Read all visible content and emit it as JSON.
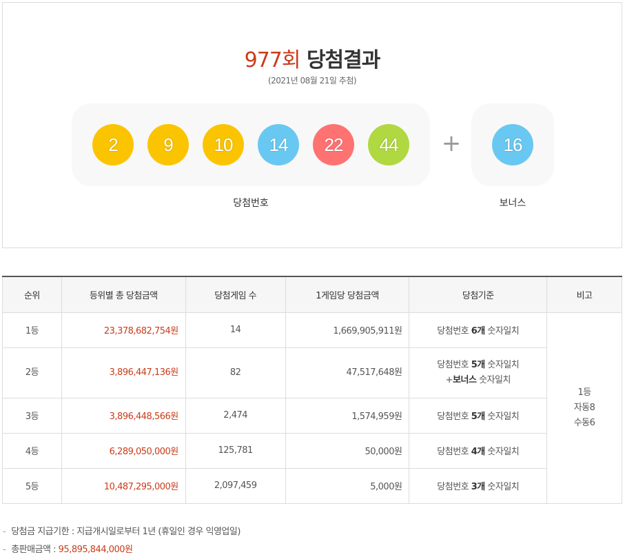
{
  "header": {
    "round": "977회",
    "title_suffix": "당첨결과",
    "draw_date": "(2021년 08월 21일 추첨)"
  },
  "numbers": [
    {
      "value": "2",
      "color": "#fbc400"
    },
    {
      "value": "9",
      "color": "#fbc400"
    },
    {
      "value": "10",
      "color": "#fbc400"
    },
    {
      "value": "14",
      "color": "#69c8f2"
    },
    {
      "value": "22",
      "color": "#ff7272"
    },
    {
      "value": "44",
      "color": "#b0d840"
    }
  ],
  "plus_symbol": "+",
  "bonus": {
    "value": "16",
    "color": "#69c8f2"
  },
  "labels": {
    "winning": "당첨번호",
    "bonus": "보너스"
  },
  "table": {
    "headers": [
      "순위",
      "등위별 총 당첨금액",
      "당첨게임 수",
      "1게임당 당첨금액",
      "당첨기준",
      "비고"
    ],
    "rows": [
      {
        "rank": "1등",
        "total": "23,378,682,754원",
        "games": "14",
        "per_game": "1,669,905,911원",
        "crit_a": "당첨번호 ",
        "crit_b": "6개",
        "crit_c": " 숫자일치"
      },
      {
        "rank": "2등",
        "total": "3,896,447,136원",
        "games": "82",
        "per_game": "47,517,648원",
        "crit_a": "당첨번호 ",
        "crit_b": "5개",
        "crit_c": " 숫자일치",
        "crit_d": "+",
        "crit_e": "보너스",
        "crit_f": " 숫자일치"
      },
      {
        "rank": "3등",
        "total": "3,896,448,566원",
        "games": "2,474",
        "per_game": "1,574,959원",
        "crit_a": "당첨번호 ",
        "crit_b": "5개",
        "crit_c": " 숫자일치"
      },
      {
        "rank": "4등",
        "total": "6,289,050,000원",
        "games": "125,781",
        "per_game": "50,000원",
        "crit_a": "당첨번호 ",
        "crit_b": "4개",
        "crit_c": " 숫자일치"
      },
      {
        "rank": "5등",
        "total": "10,487,295,000원",
        "games": "2,097,459",
        "per_game": "5,000원",
        "crit_a": "당첨번호 ",
        "crit_b": "3개",
        "crit_c": " 숫자일치"
      }
    ],
    "note": {
      "line1": "1등",
      "line2": "자동8",
      "line3": "수동6"
    }
  },
  "footer": {
    "dash": "-",
    "deadline": "당첨금 지급기한 : 지급개시일로부터 1년 (휴일인 경우 익영업일)",
    "sales_label": "총판매금액 : ",
    "sales_value": "95,895,844,000원"
  },
  "colors": {
    "accent": "#c93c1a"
  }
}
